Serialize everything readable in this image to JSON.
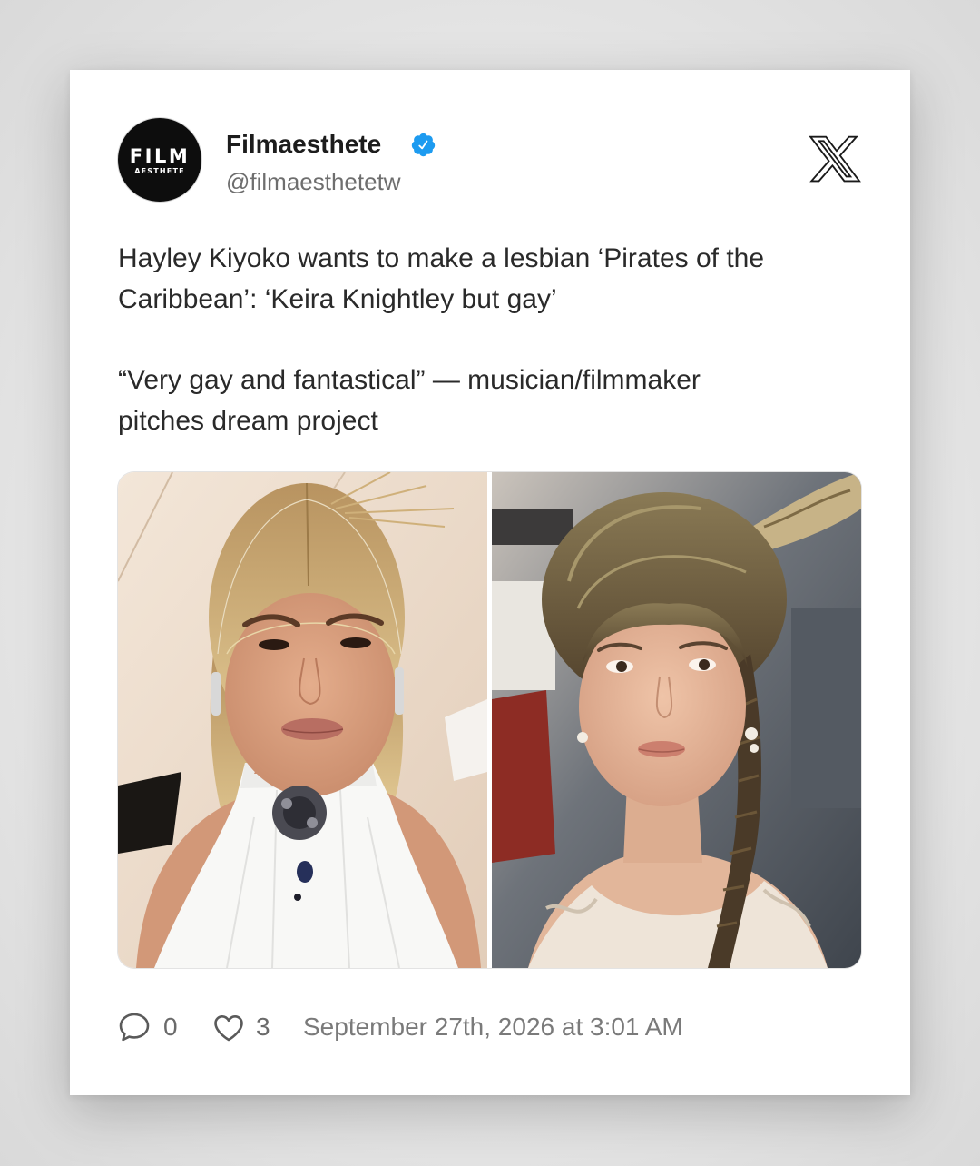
{
  "author": {
    "name": "Filmaesthete",
    "handle": "@filmaesthetetw",
    "verified": true,
    "avatar": {
      "line1": "FILM",
      "line2": "AESTHETE"
    }
  },
  "tweet": {
    "paragraphs": [
      {
        "lines": [
          "Hayley Kiyoko wants to make a lesbian ‘Pirates of the",
          "Caribbean’: ‘Keira Knightley but gay’"
        ]
      },
      {
        "lines": [
          "“Very gay and fantastical” — musician/filmmaker",
          "pitches dream project"
        ]
      }
    ]
  },
  "footer": {
    "comments": "0",
    "likes": "3",
    "timestamp": "September 27th, 2026 at 3:01 AM"
  },
  "icons": {
    "verified": "verified-badge-icon",
    "platform": "x-logo-icon",
    "comment": "comment-bubble-icon",
    "like": "heart-icon"
  },
  "colors": {
    "verified_blue": "#1d9bf0",
    "text_primary": "#2a2a2a",
    "text_secondary": "#6e6e6e",
    "card_background": "#ffffff"
  }
}
